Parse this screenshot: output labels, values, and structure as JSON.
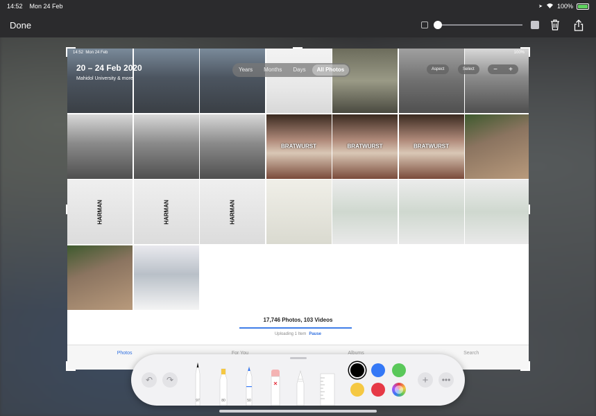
{
  "status": {
    "time": "14:52",
    "date": "Mon 24 Feb",
    "battery": "100%"
  },
  "toolbar": {
    "done_label": "Done"
  },
  "screenshot": {
    "status_time": "14:52",
    "status_date": "Mon 24 Feb",
    "status_battery": "100%",
    "date_range": "20 – 24 Feb 2020",
    "location": "Mahidol University & more",
    "segments": [
      "Years",
      "Months",
      "Days",
      "All Photos"
    ],
    "active_segment": "All Photos",
    "aspect_label": "Aspect",
    "select_label": "Select",
    "minus_label": "−",
    "plus_label": "+",
    "counts": "17,746 Photos, 103 Videos",
    "uploading": "Uploading 1 Item",
    "pause": "Pause",
    "upload_progress": 1.0,
    "tabs": [
      "Photos",
      "For You",
      "Albums",
      "Search"
    ],
    "thumbnails": [
      {
        "kind": "street",
        "label": ""
      },
      {
        "kind": "street",
        "label": ""
      },
      {
        "kind": "street",
        "label": ""
      },
      {
        "kind": "chart",
        "label": ""
      },
      {
        "kind": "device",
        "label": ""
      },
      {
        "kind": "people",
        "label": ""
      },
      {
        "kind": "bw",
        "label": ""
      },
      {
        "kind": "bw",
        "label": ""
      },
      {
        "kind": "bw",
        "label": ""
      },
      {
        "kind": "bw",
        "label": ""
      },
      {
        "kind": "food",
        "label": "BRATWURST"
      },
      {
        "kind": "food",
        "label": "BRATWURST"
      },
      {
        "kind": "food",
        "label": "BRATWURST"
      },
      {
        "kind": "sidewalk",
        "label": ""
      },
      {
        "kind": "box",
        "label": "HARMAN"
      },
      {
        "kind": "box",
        "label": "HARMAN"
      },
      {
        "kind": "box",
        "label": "HARMAN"
      },
      {
        "kind": "doc",
        "label": ""
      },
      {
        "kind": "camera",
        "label": ""
      },
      {
        "kind": "camera",
        "label": ""
      },
      {
        "kind": "camera",
        "label": ""
      },
      {
        "kind": "sidewalk",
        "label": ""
      },
      {
        "kind": "screen",
        "label": ""
      }
    ]
  },
  "palette": {
    "pen_size": "97",
    "marker_size": "80",
    "pencil_size": "50",
    "colors": [
      "#000000",
      "#3478f6",
      "#5ac85a",
      "#f5c842",
      "#e63946"
    ],
    "selected_color": "#000000"
  }
}
